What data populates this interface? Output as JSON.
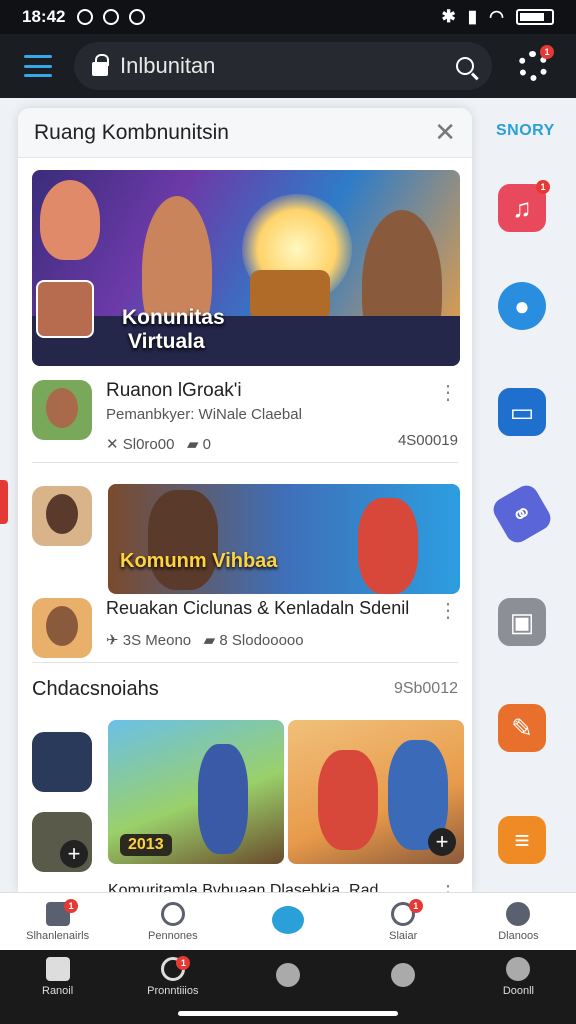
{
  "status": {
    "time": "18:42"
  },
  "appbar": {
    "address": "Inlbunitan"
  },
  "panel": {
    "title": "Ruang Kombnunitsin"
  },
  "hero": {
    "tag_line1": "Konunitas",
    "tag_line2": "Virtuala"
  },
  "item1": {
    "title": "Ruanon lGroak'i",
    "subtitle": "Pemanbkyer:  WiNale Claebal",
    "stat_a": "✕ Sl0ro00",
    "stat_b": "0",
    "count": "4S00019"
  },
  "banner2": {
    "tag": "Komunm Vihbaa"
  },
  "item2": {
    "title": "Reuakan Ciclunas & Kenladaln Sdenil",
    "stat_a": "3S Meono",
    "stat_b": "8 Slodooooo"
  },
  "section": {
    "title": "Chdacsnoiahs",
    "count": "9Sb0012"
  },
  "grid": {
    "year": "2013"
  },
  "bottom_caption": "Komuritamla Bvbuaan  Dlasebkia. Rad ...",
  "rail": {
    "title": "SNORY"
  },
  "tabs_light": [
    {
      "label": "Slhanlenairls"
    },
    {
      "label": "Pennones"
    },
    {
      "label": ""
    },
    {
      "label": "Slaiar"
    },
    {
      "label": "Dlanoos"
    }
  ],
  "tabs_dark": [
    {
      "label": "Ranoil"
    },
    {
      "label": "Pronntiiios"
    },
    {
      "label": ""
    },
    {
      "label": ""
    },
    {
      "label": "Doonll"
    }
  ],
  "badges": {
    "one": "1"
  },
  "colors": {
    "accent": "#2a9fd8",
    "badge": "#e53935"
  }
}
